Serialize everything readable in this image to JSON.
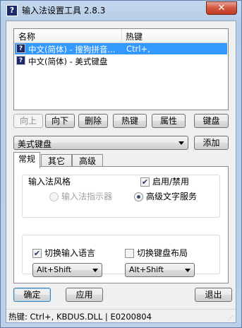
{
  "window": {
    "title": "输入法设置工具 2.8.3",
    "close": "✕",
    "icon_glyph": "?"
  },
  "list": {
    "headers": [
      "名称",
      "热键"
    ],
    "rows": [
      {
        "name": "中文(简体) - 搜狗拼音...",
        "hotkey": "Ctrl+,",
        "selected": true
      },
      {
        "name": "中文(简体) - 美式键盘",
        "hotkey": "",
        "selected": false
      }
    ]
  },
  "buttons": {
    "up": "向上",
    "down": "向下",
    "delete": "删除",
    "hotkey": "热键",
    "properties": "属性",
    "keyboard": "键盘",
    "add": "添加",
    "ok": "确定",
    "apply": "应用",
    "exit": "退出"
  },
  "layout_combo": {
    "value": "美式键盘"
  },
  "tabs": [
    "常规",
    "其它",
    "高级"
  ],
  "general": {
    "group_title": "输入法风格",
    "enable_label": "启用/禁用",
    "enable_checked": true,
    "radio_indicator": "输入法指示器",
    "radio_tsf": "高级文字服务",
    "switch_lang_label": "切换输入语言",
    "switch_lang_checked": true,
    "switch_layout_label": "切换键盘布局",
    "switch_layout_checked": false,
    "switch_lang_value": "Alt+Shift",
    "switch_layout_value": "Alt+Shift"
  },
  "status": "热键: Ctrl+, KBDUS.DLL | E0200804"
}
